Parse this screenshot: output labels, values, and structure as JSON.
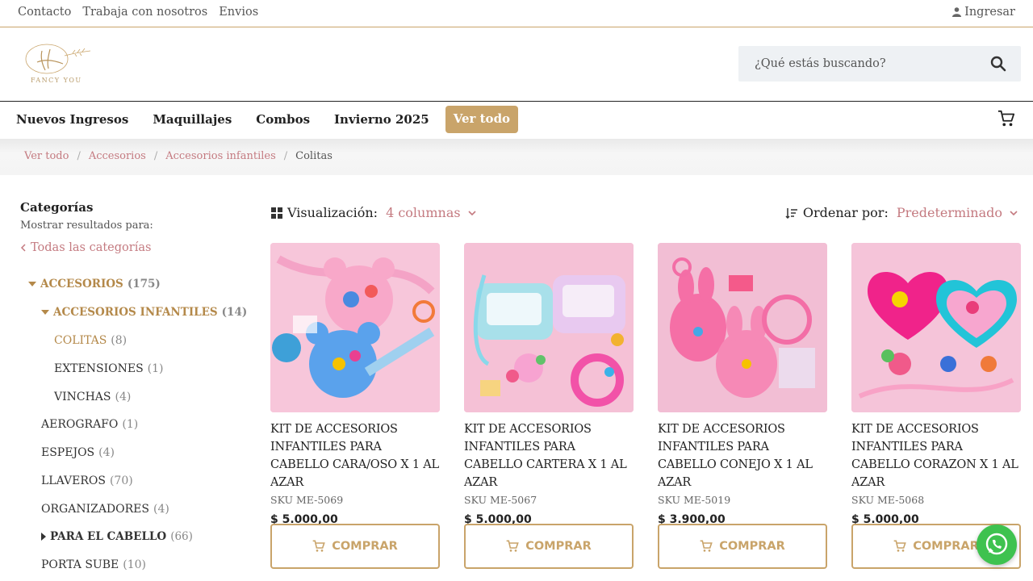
{
  "topbar": {
    "links": [
      "Contacto",
      "Trabaja con nosotros",
      "Envios"
    ],
    "login_label": "Ingresar"
  },
  "header": {
    "logo_text": "FANCY YOU",
    "search_placeholder": "¿Qué estás buscando?"
  },
  "nav": {
    "items": [
      "Nuevos Ingresos",
      "Maquillajes",
      "Combos",
      "Invierno 2025"
    ],
    "cta": "Ver todo"
  },
  "breadcrumb": {
    "links": [
      "Ver todo",
      "Accesorios",
      "Accesorios infantiles"
    ],
    "current": "Colitas"
  },
  "sidebar": {
    "title": "Categorías",
    "subtitle": "Mostrar resultados para:",
    "all_label": "Todas las categorías",
    "categories": [
      {
        "name": "ACCESORIOS",
        "count": "(175)"
      },
      {
        "name": "ACCESORIOS INFANTILES",
        "count": "(14)"
      },
      {
        "name": "COLITAS",
        "count": "(8)"
      },
      {
        "name": "EXTENSIONES",
        "count": "(1)"
      },
      {
        "name": "VINCHAS",
        "count": "(4)"
      },
      {
        "name": "AEROGRAFO",
        "count": "(1)"
      },
      {
        "name": "ESPEJOS",
        "count": "(4)"
      },
      {
        "name": "LLAVEROS",
        "count": "(70)"
      },
      {
        "name": "ORGANIZADORES",
        "count": "(4)"
      },
      {
        "name": "PARA EL CABELLO",
        "count": "(66)"
      },
      {
        "name": "PORTA SUBE",
        "count": "(10)"
      }
    ]
  },
  "toolbar": {
    "view_label": "Visualización:",
    "view_value": "4 columnas",
    "sort_label": "Ordenar por:",
    "sort_value": "Predeterminado"
  },
  "products": [
    {
      "name": "KIT DE ACCESORIOS INFANTILES PARA CABELLO CARA/OSO X 1 AL AZAR",
      "sku": "SKU ME-5069",
      "price": "$  5.000,00"
    },
    {
      "name": "KIT DE ACCESORIOS INFANTILES PARA CABELLO CARTERA X 1 AL AZAR",
      "sku": "SKU ME-5067",
      "price": "$  5.000,00"
    },
    {
      "name": "KIT DE ACCESORIOS INFANTILES PARA CABELLO CONEJO X 1 AL AZAR",
      "sku": "SKU ME-5019",
      "price": "$  3.900,00"
    },
    {
      "name": "KIT DE ACCESORIOS INFANTILES PARA CABELLO CORAZON X 1 AL AZAR",
      "sku": "SKU ME-5068",
      "price": "$  5.000,00"
    }
  ],
  "buy_label": "COMPRAR",
  "colors": {
    "accent": "#c9a46a",
    "link": "#c47a80",
    "whatsapp": "#3ec24f"
  }
}
